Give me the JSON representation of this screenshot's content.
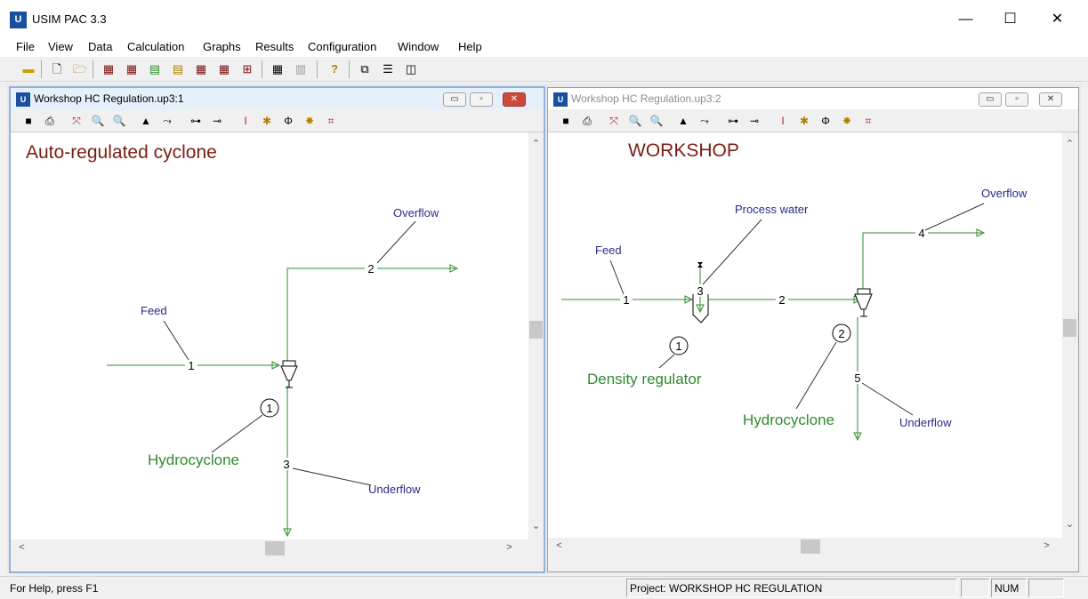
{
  "app": {
    "icon_text": "U",
    "title": "USIM PAC 3.3"
  },
  "window_buttons": {
    "minimize": "—",
    "maximize": "☐",
    "close": "✕"
  },
  "menu": [
    "File",
    "View",
    "Data",
    "Calculation",
    "Graphs",
    "Results",
    "Configuration",
    "Window",
    "Help"
  ],
  "windows": [
    {
      "title": "Workshop HC Regulation.up3:1",
      "heading": "Auto-regulated cyclone",
      "streams": [
        {
          "id": "1",
          "label": "Feed"
        },
        {
          "id": "2",
          "label": "Overflow"
        },
        {
          "id": "3",
          "label": "Underflow"
        }
      ],
      "units": [
        {
          "id": "1",
          "label": "Hydrocyclone"
        }
      ]
    },
    {
      "title": "Workshop HC Regulation.up3:2",
      "heading": "WORKSHOP",
      "streams": [
        {
          "id": "1",
          "label": "Feed"
        },
        {
          "id": "2",
          "label": ""
        },
        {
          "id": "3",
          "label": "Process water"
        },
        {
          "id": "4",
          "label": "Overflow"
        },
        {
          "id": "5",
          "label": "Underflow"
        }
      ],
      "units": [
        {
          "id": "1",
          "label": "Density regulator"
        },
        {
          "id": "2",
          "label": "Hydrocyclone"
        }
      ]
    }
  ],
  "status": {
    "help": "For Help, press F1",
    "project": "Project: WORKSHOP HC REGULATION",
    "num": "NUM"
  },
  "colors": {
    "heading": "#7b1d12",
    "stream_line": "#2e8b2e",
    "stream_label": "#2a2a8a",
    "unit_label": "#2e8b2e",
    "active_border": "#8fb4dc"
  }
}
